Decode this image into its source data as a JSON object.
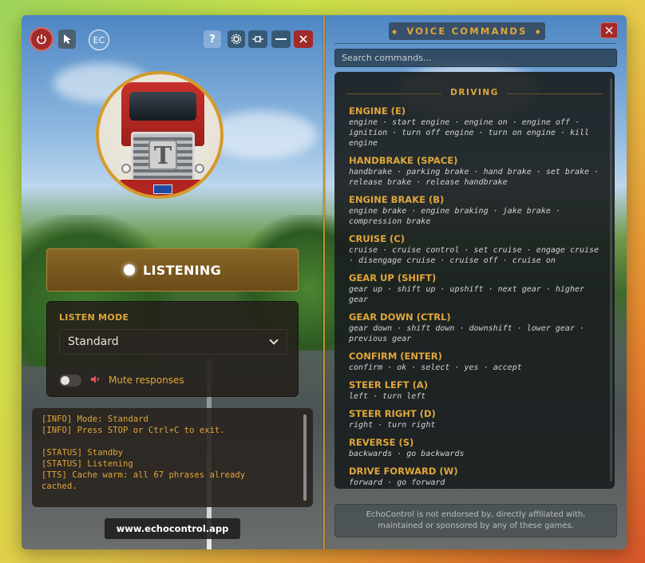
{
  "colors": {
    "accent": "#e0a63a",
    "danger": "#a32a2a",
    "panel": "#1a1e20",
    "button_blue": "#365a76"
  },
  "left": {
    "top_icons": [
      "power-icon",
      "cursor-icon",
      "ec-logo",
      "help-icon",
      "gear-icon",
      "pin-icon",
      "minimize-icon",
      "close-icon"
    ],
    "ec_label": "EC",
    "help_label": "?",
    "listen_button_label": "LISTENING",
    "listen_mode_title": "LISTEN MODE",
    "listen_mode_value": "Standard",
    "mute_label": "Mute responses",
    "mute_enabled": false,
    "console": [
      "[INFO] Mode: Standard",
      "[INFO] Press STOP or Ctrl+C to exit.",
      "",
      "[STATUS] Standby",
      "[STATUS] Listening",
      "[TTS] Cache warm: all 67 phrases already",
      "cached."
    ],
    "website": "www.echocontrol.app"
  },
  "right": {
    "title": "VOICE COMMANDS",
    "title_decor": "◆",
    "search_placeholder": "Search commands...",
    "category": "DRIVING",
    "commands": [
      {
        "name": "ENGINE (E)",
        "phrases": "engine · start engine · engine on · engine off · ignition · turn off engine · turn on engine · kill engine"
      },
      {
        "name": "HANDBRAKE (SPACE)",
        "phrases": "handbrake · parking brake · hand brake · set brake · release brake · release handbrake"
      },
      {
        "name": "ENGINE BRAKE (B)",
        "phrases": "engine brake · engine braking · jake brake · compression brake"
      },
      {
        "name": "CRUISE (C)",
        "phrases": "cruise · cruise control · set cruise · engage cruise · disengage cruise · cruise off · cruise on"
      },
      {
        "name": "GEAR UP (SHIFT)",
        "phrases": "gear up · shift up · upshift · next gear · higher gear"
      },
      {
        "name": "GEAR DOWN (CTRL)",
        "phrases": "gear down · shift down · downshift · lower gear · previous gear"
      },
      {
        "name": "CONFIRM (ENTER)",
        "phrases": "confirm · ok · select · yes · accept"
      },
      {
        "name": "STEER LEFT (A)",
        "phrases": "left · turn left"
      },
      {
        "name": "STEER RIGHT (D)",
        "phrases": "right · turn right"
      },
      {
        "name": "REVERSE (S)",
        "phrases": "backwards · go backwards"
      },
      {
        "name": "DRIVE FORWARD (W)",
        "phrases": "forward · go forward"
      }
    ],
    "disclaimer": "EchoControl is not endorsed by, directly affiliated with, maintained or sponsored by any of these games."
  }
}
